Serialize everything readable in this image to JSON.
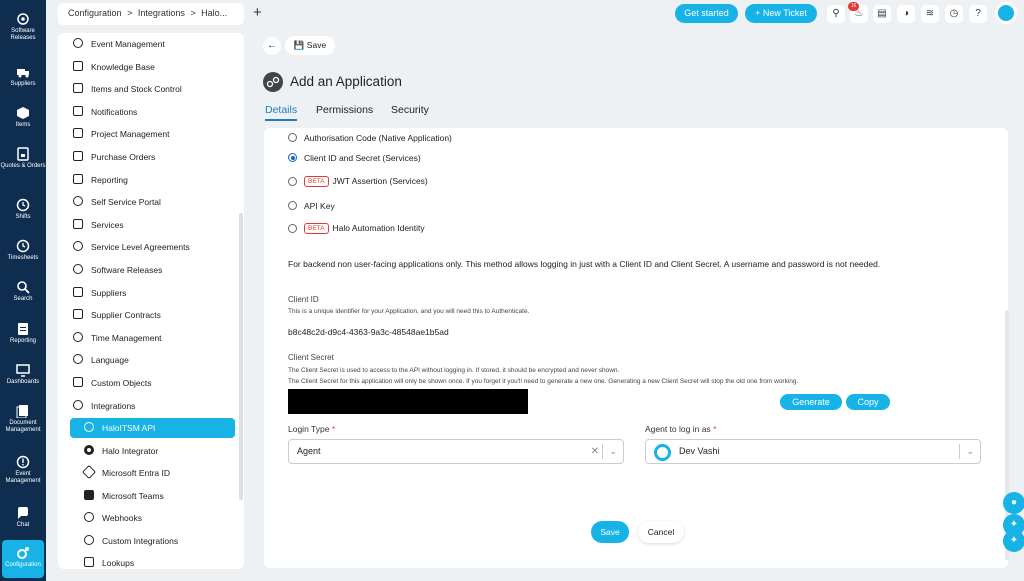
{
  "rail": [
    {
      "label": "Software Releases",
      "icon": "gear-sparkle-icon"
    },
    {
      "label": "Suppliers",
      "icon": "truck-icon"
    },
    {
      "label": "Items",
      "icon": "box-icon"
    },
    {
      "label": "Quotes & Orders",
      "icon": "quote-icon"
    },
    {
      "label": "Shifts",
      "icon": "clock-icon"
    },
    {
      "label": "Timesheets",
      "icon": "clock-icon"
    },
    {
      "label": "Search",
      "icon": "search-icon"
    },
    {
      "label": "Reporting",
      "icon": "report-icon"
    },
    {
      "label": "Dashboards",
      "icon": "monitor-icon"
    },
    {
      "label": "Document Management",
      "icon": "document-icon"
    },
    {
      "label": "Event Management",
      "icon": "alert-icon"
    },
    {
      "label": "Chat",
      "icon": "chat-icon"
    },
    {
      "label": "Configuration",
      "icon": "cog-icon"
    }
  ],
  "breadcrumb": {
    "a": "Configuration",
    "sep": ">",
    "b": "Integrations",
    "c": "Halo..."
  },
  "topbar": {
    "plus": "+",
    "get_started": "Get started",
    "new_ticket": "+ New Ticket",
    "notif_count": "16"
  },
  "sidebar": {
    "items": [
      "Event Management",
      "Knowledge Base",
      "Items and Stock Control",
      "Notifications",
      "Project Management",
      "Purchase Orders",
      "Reporting",
      "Self Service Portal",
      "Services",
      "Service Level Agreements",
      "Software Releases",
      "Suppliers",
      "Supplier Contracts",
      "Time Management",
      "Language",
      "Custom Objects",
      "Integrations"
    ],
    "sub_items": [
      "HaloITSM API",
      "Halo Integrator",
      "Microsoft Entra ID",
      "Microsoft Teams",
      "Webhooks",
      "Custom Integrations",
      "Lookups"
    ]
  },
  "main": {
    "save_label": "Save",
    "title": "Add an Application",
    "tabs": [
      "Details",
      "Permissions",
      "Security"
    ],
    "auth_options": [
      {
        "label": "Authorisation Code (Native Application)",
        "beta": false,
        "selected": false
      },
      {
        "label": "Client ID and Secret (Services)",
        "beta": false,
        "selected": true
      },
      {
        "label": "JWT Assertion (Services)",
        "beta": true,
        "selected": false
      },
      {
        "label": "API Key",
        "beta": false,
        "selected": false
      },
      {
        "label": "Halo Automation Identity",
        "beta": true,
        "selected": false
      }
    ],
    "beta_label": "BETA",
    "description": "For backend non user-facing applications only. This method allows logging in just with a Client ID and Client Secret. A username and password is not needed.",
    "client_id_label": "Client ID",
    "client_id_help": "This is a unique identifier for your Application, and you will need this to Authenticate.",
    "client_id_value": "b8c48c2d-d9c4-4363-9a3c-48548ae1b5ad",
    "client_secret_label": "Client Secret",
    "client_secret_help1": "The Client Secret is used to access to the API without logging in. If stored, it should be encrypted and never shown.",
    "client_secret_help2": "The Client Secret for this application will only be shown once. If you forget it you'll need to generate a new one. Generating a new Client Secret will stop the old one from working.",
    "generate_label": "Generate",
    "copy_label": "Copy",
    "login_type_label": "Login Type",
    "login_type_value": "Agent",
    "agent_label": "Agent to log in as",
    "agent_value": "Dev Vashi",
    "required_mark": "*",
    "save_bottom": "Save",
    "cancel_bottom": "Cancel"
  },
  "colors": {
    "accent": "#17b3e6",
    "rail": "#0f2e4f",
    "required": "#e53935"
  }
}
